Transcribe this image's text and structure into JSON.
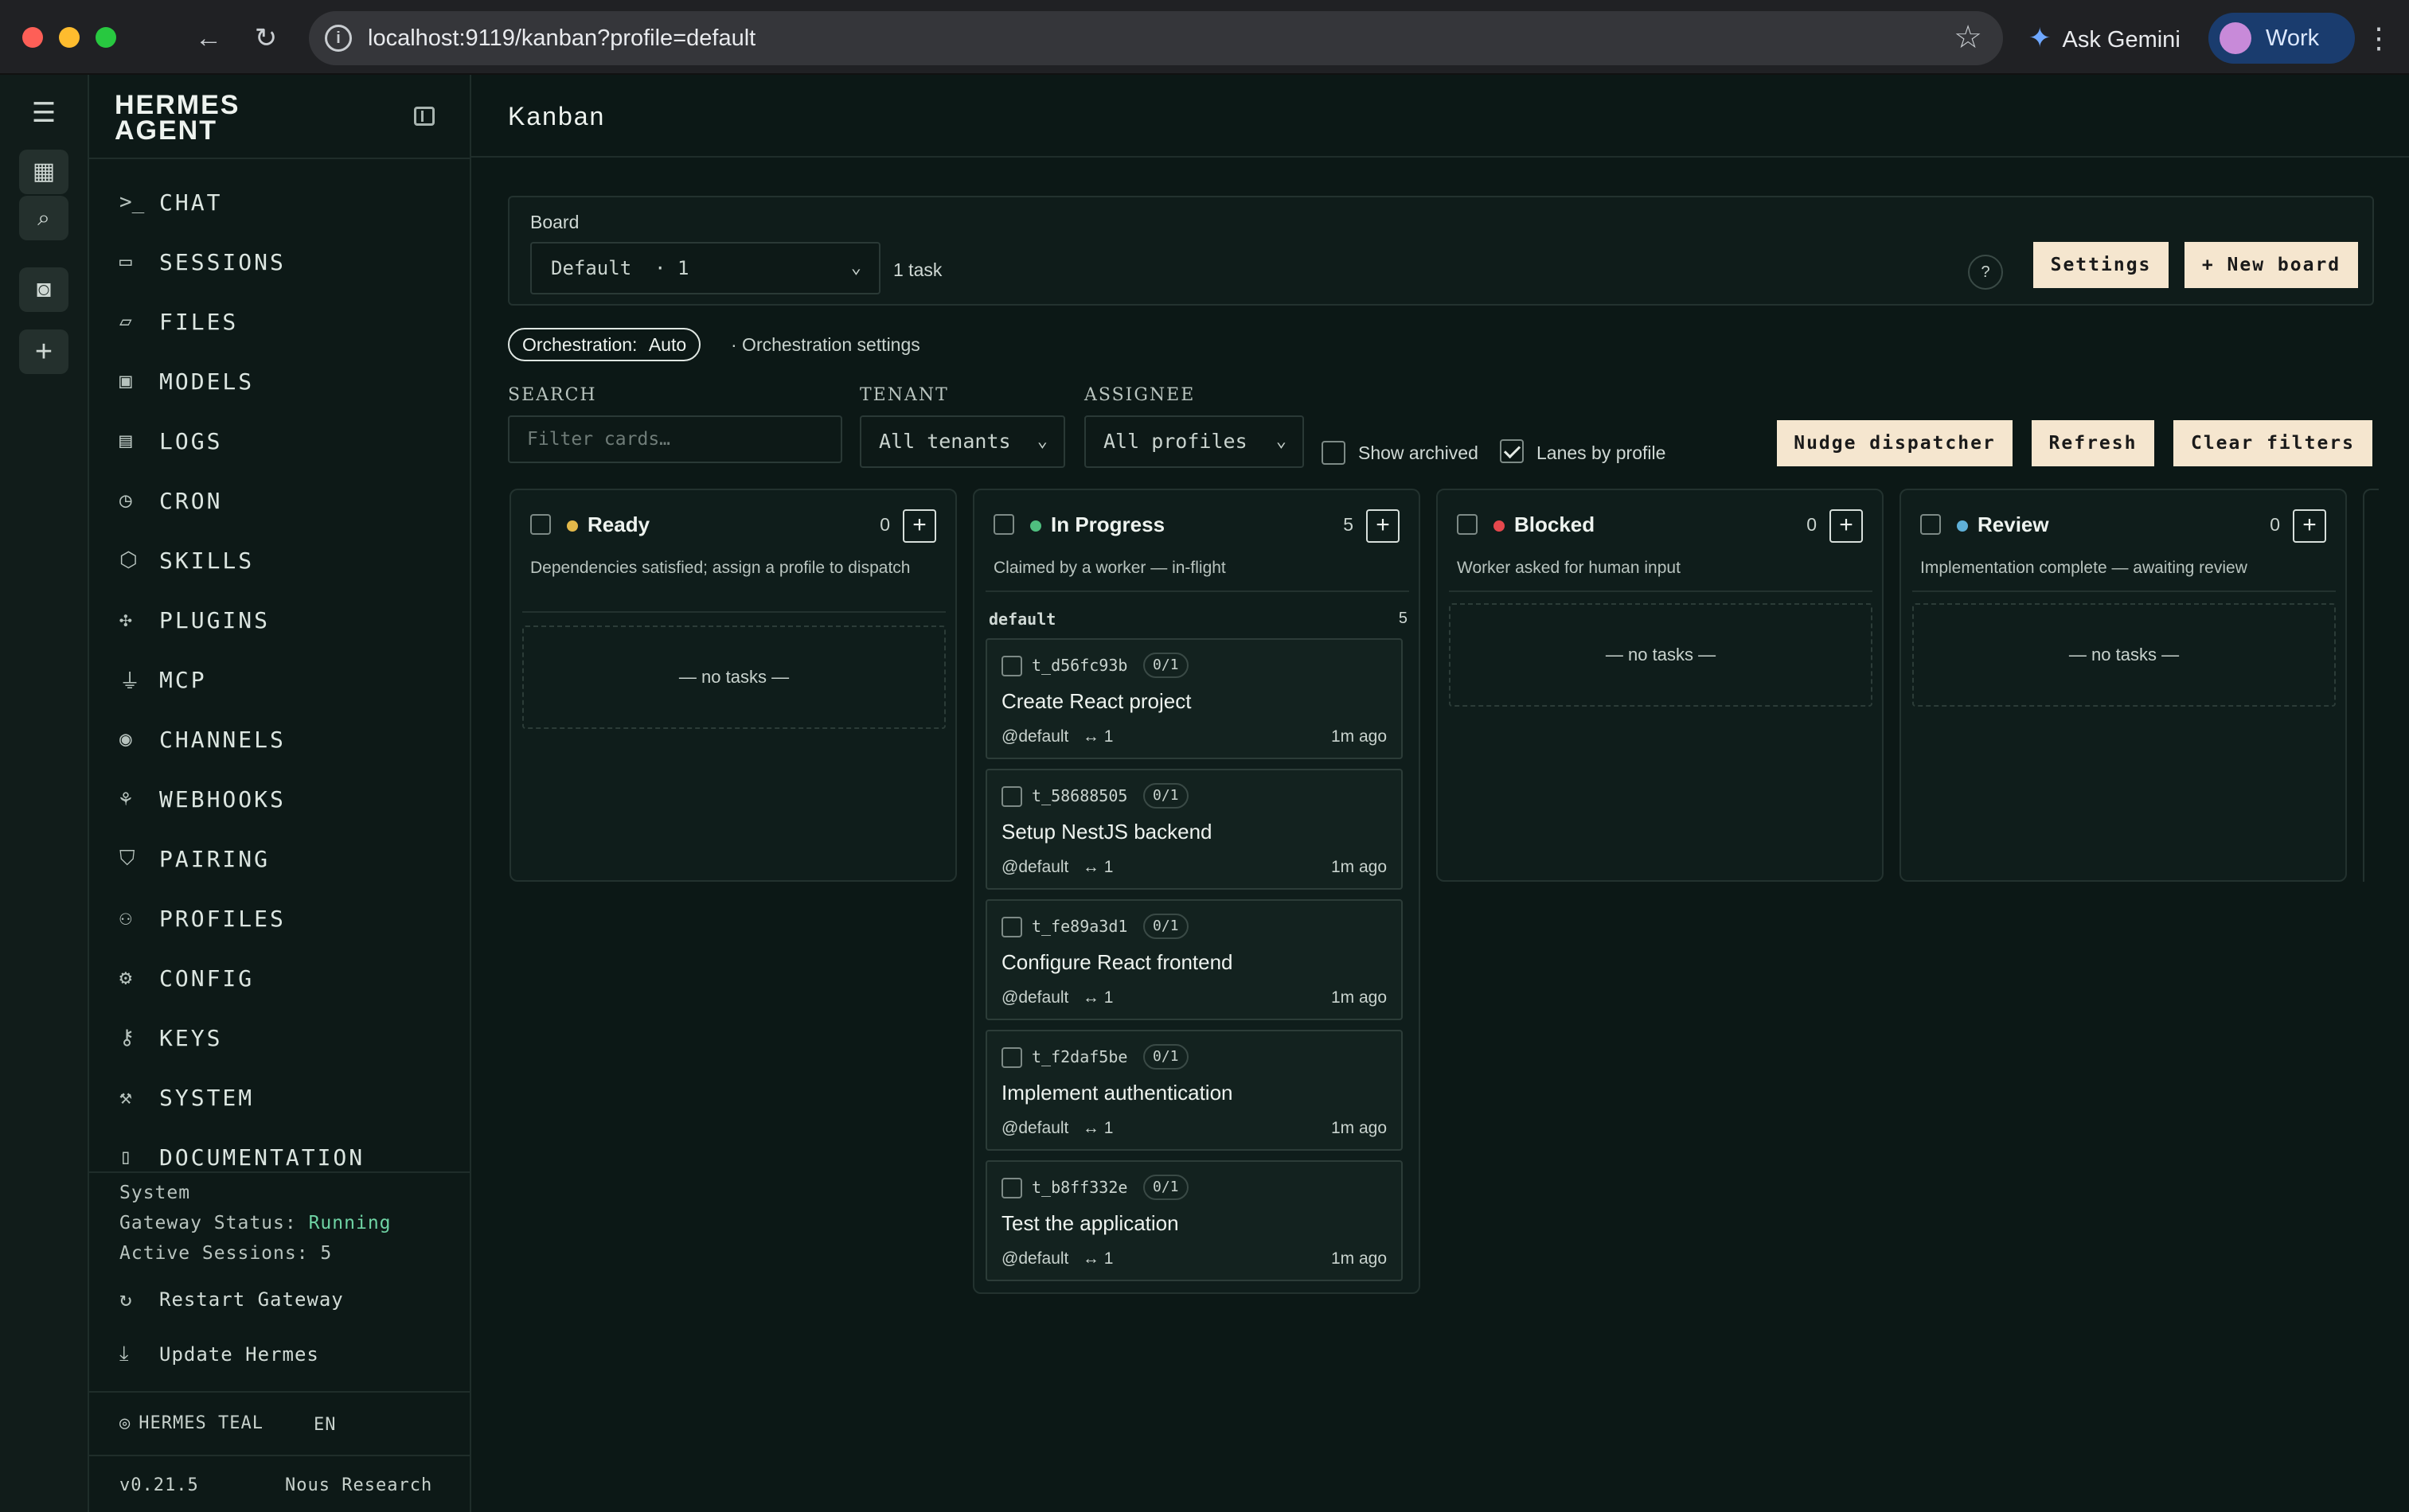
{
  "browser": {
    "url": "localhost:9119/kanban?profile=default",
    "ask_gemini": "Ask Gemini",
    "profile_name": "Work"
  },
  "sidebar": {
    "brand_line1": "HERMES",
    "brand_line2": "AGENT",
    "nav": [
      {
        "label": "CHAT",
        "icon": "terminal-icon"
      },
      {
        "label": "SESSIONS",
        "icon": "chat-bubble-icon"
      },
      {
        "label": "FILES",
        "icon": "folder-icon"
      },
      {
        "label": "MODELS",
        "icon": "chip-icon"
      },
      {
        "label": "LOGS",
        "icon": "document-icon"
      },
      {
        "label": "CRON",
        "icon": "clock-icon"
      },
      {
        "label": "SKILLS",
        "icon": "package-icon"
      },
      {
        "label": "PLUGINS",
        "icon": "puzzle-icon"
      },
      {
        "label": "MCP",
        "icon": "plug-icon"
      },
      {
        "label": "CHANNELS",
        "icon": "broadcast-icon"
      },
      {
        "label": "WEBHOOKS",
        "icon": "webhook-icon"
      },
      {
        "label": "PAIRING",
        "icon": "shield-icon"
      },
      {
        "label": "PROFILES",
        "icon": "users-icon"
      },
      {
        "label": "CONFIG",
        "icon": "gear-icon"
      },
      {
        "label": "KEYS",
        "icon": "key-icon"
      },
      {
        "label": "SYSTEM",
        "icon": "wrench-icon"
      },
      {
        "label": "DOCUMENTATION",
        "icon": "book-icon"
      }
    ],
    "system": {
      "heading": "System",
      "gateway_label": "Gateway Status:",
      "gateway_value": "Running",
      "sessions_label": "Active Sessions:",
      "sessions_value": "5",
      "restart": "Restart Gateway",
      "update": "Update Hermes"
    },
    "theme": "HERMES TEAL",
    "language": "EN",
    "version": "v0.21.5",
    "org": "Nous Research"
  },
  "main": {
    "title": "Kanban",
    "board": {
      "label": "Board",
      "selected": "Default  · 1",
      "count": "1 task",
      "help": "?",
      "settings": "Settings",
      "new_board": "+ New board"
    },
    "orchestration": {
      "pill_label": "Orchestration:",
      "pill_value": "Auto",
      "settings_link": "· Orchestration settings"
    },
    "filters": {
      "search_label": "SEARCH",
      "search_placeholder": "Filter cards…",
      "tenant_label": "TENANT",
      "tenant_value": "All tenants",
      "assignee_label": "ASSIGNEE",
      "assignee_value": "All profiles",
      "show_archived": "Show archived",
      "lanes_by_profile": "Lanes by profile",
      "nudge": "Nudge dispatcher",
      "refresh": "Refresh",
      "clear": "Clear filters"
    },
    "columns": [
      {
        "title": "Ready",
        "count": "0",
        "color": "#e2b84a",
        "desc": "Dependencies satisfied; assign a profile to dispatch",
        "empty": "— no tasks —"
      },
      {
        "title": "In Progress",
        "count": "5",
        "color": "#4fbf7f",
        "desc": "Claimed by a worker — in-flight",
        "lane": "default",
        "lane_count": "5"
      },
      {
        "title": "Blocked",
        "count": "0",
        "color": "#e5484d",
        "desc": "Worker asked for human input",
        "empty": "— no tasks —"
      },
      {
        "title": "Review",
        "count": "0",
        "color": "#5fb0d8",
        "desc": "Implementation complete — awaiting review",
        "empty": "— no tasks —"
      }
    ],
    "cards": [
      {
        "id": "t_d56fc93b",
        "badge": "0/1",
        "title": "Create React project",
        "assignee": "@default",
        "links": "↔ 1",
        "time": "1m ago"
      },
      {
        "id": "t_58688505",
        "badge": "0/1",
        "title": "Setup NestJS backend",
        "assignee": "@default",
        "links": "↔ 1",
        "time": "1m ago"
      },
      {
        "id": "t_fe89a3d1",
        "badge": "0/1",
        "title": "Configure React frontend",
        "assignee": "@default",
        "links": "↔ 1",
        "time": "1m ago"
      },
      {
        "id": "t_f2daf5be",
        "badge": "0/1",
        "title": "Implement authentication",
        "assignee": "@default",
        "links": "↔ 1",
        "time": "1m ago"
      },
      {
        "id": "t_b8ff332e",
        "badge": "0/1",
        "title": "Test the application",
        "assignee": "@default",
        "links": "↔ 1",
        "time": "1m ago"
      }
    ]
  }
}
